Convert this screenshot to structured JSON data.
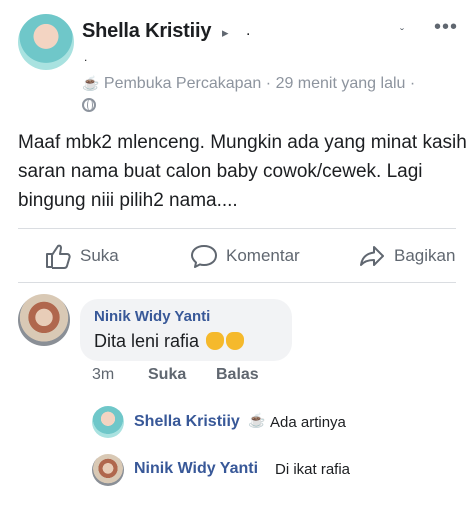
{
  "post": {
    "author": "Shella Kristiiy",
    "author_suffix": "▸ .",
    "activity": "Pembuka Percakapan",
    "time": "29 menit yang lalu",
    "separator": "·",
    "text": "Maaf mbk2 mlenceng. Mungkin ada yang minat kasih saran nama buat calon baby cowok/cewek. Lagi bingung niii pilih2 nama...."
  },
  "actions": {
    "like": "Suka",
    "comment": "Komentar",
    "share": "Bagikan"
  },
  "comment": {
    "author": "Ninik Widy Yanti",
    "text": "Dita leni rafia",
    "time": "3m",
    "like": "Suka",
    "reply": "Balas"
  },
  "replies": [
    {
      "author": "Shella Kristiiy",
      "text": "Ada artinya"
    },
    {
      "author": "Ninik Widy Yanti",
      "text": "Di ikat rafia"
    }
  ],
  "icons": {
    "more": "more-options-icon",
    "globe": "globe-icon",
    "cup": "coffee-cup-icon",
    "like": "thumbs-up-icon",
    "comment": "speech-bubble-icon",
    "share": "share-arrow-icon"
  },
  "colors": {
    "name_link": "#385898",
    "meta_gray": "#8d949e",
    "action_gray": "#606770",
    "bubble_bg": "#f2f3f5"
  }
}
